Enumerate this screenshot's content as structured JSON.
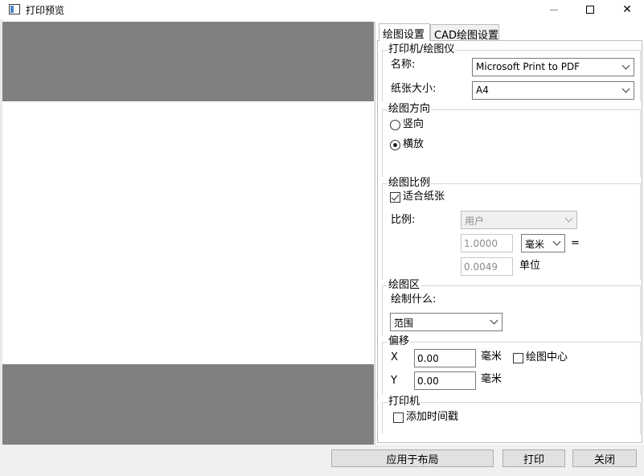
{
  "window": {
    "title": "打印预览",
    "icons": {
      "app": "window-app-icon",
      "minimize": "minimize-icon",
      "maximize": "maximize-icon",
      "close": "close-icon"
    },
    "close_glyph": "✕"
  },
  "tabs": [
    {
      "label": "绘图设置",
      "active": true
    },
    {
      "label": "CAD绘图设置",
      "active": false
    }
  ],
  "printer_group": {
    "title": "打印机/绘图仪",
    "name_label": "名称:",
    "name_value": "Microsoft Print to PDF",
    "paper_label": "纸张大小:",
    "paper_value": "A4"
  },
  "orientation_group": {
    "title": "绘图方向",
    "options": [
      {
        "label": "竖向",
        "selected": false
      },
      {
        "label": "横放",
        "selected": true
      }
    ]
  },
  "scale_group": {
    "title": "绘图比例",
    "fit_paper_label": "适合纸张",
    "fit_paper_checked": true,
    "ratio_label": "比例:",
    "ratio_value": "用户",
    "value1": "1.0000",
    "unit_value": "毫米",
    "equals": "=",
    "value2": "0.0049",
    "unit2_label": "单位"
  },
  "area_group": {
    "title": "绘图区",
    "what_label": "绘制什么:",
    "what_value": "范围"
  },
  "offset_group": {
    "title": "偏移",
    "x_label": "X",
    "x_value": "0.00",
    "x_unit": "毫米",
    "center_label": "绘图中心",
    "center_checked": false,
    "y_label": "Y",
    "y_value": "0.00",
    "y_unit": "毫米"
  },
  "printer2_group": {
    "title": "打印机",
    "timestamp_label": "添加时间戳",
    "timestamp_checked": false
  },
  "buttons": {
    "apply_layout": "应用于布局",
    "print": "打印",
    "close": "关闭"
  },
  "colors": {
    "preview_gray": "#808080",
    "paper_white": "#ffffff",
    "dialog_bg": "#f0f0f0"
  }
}
